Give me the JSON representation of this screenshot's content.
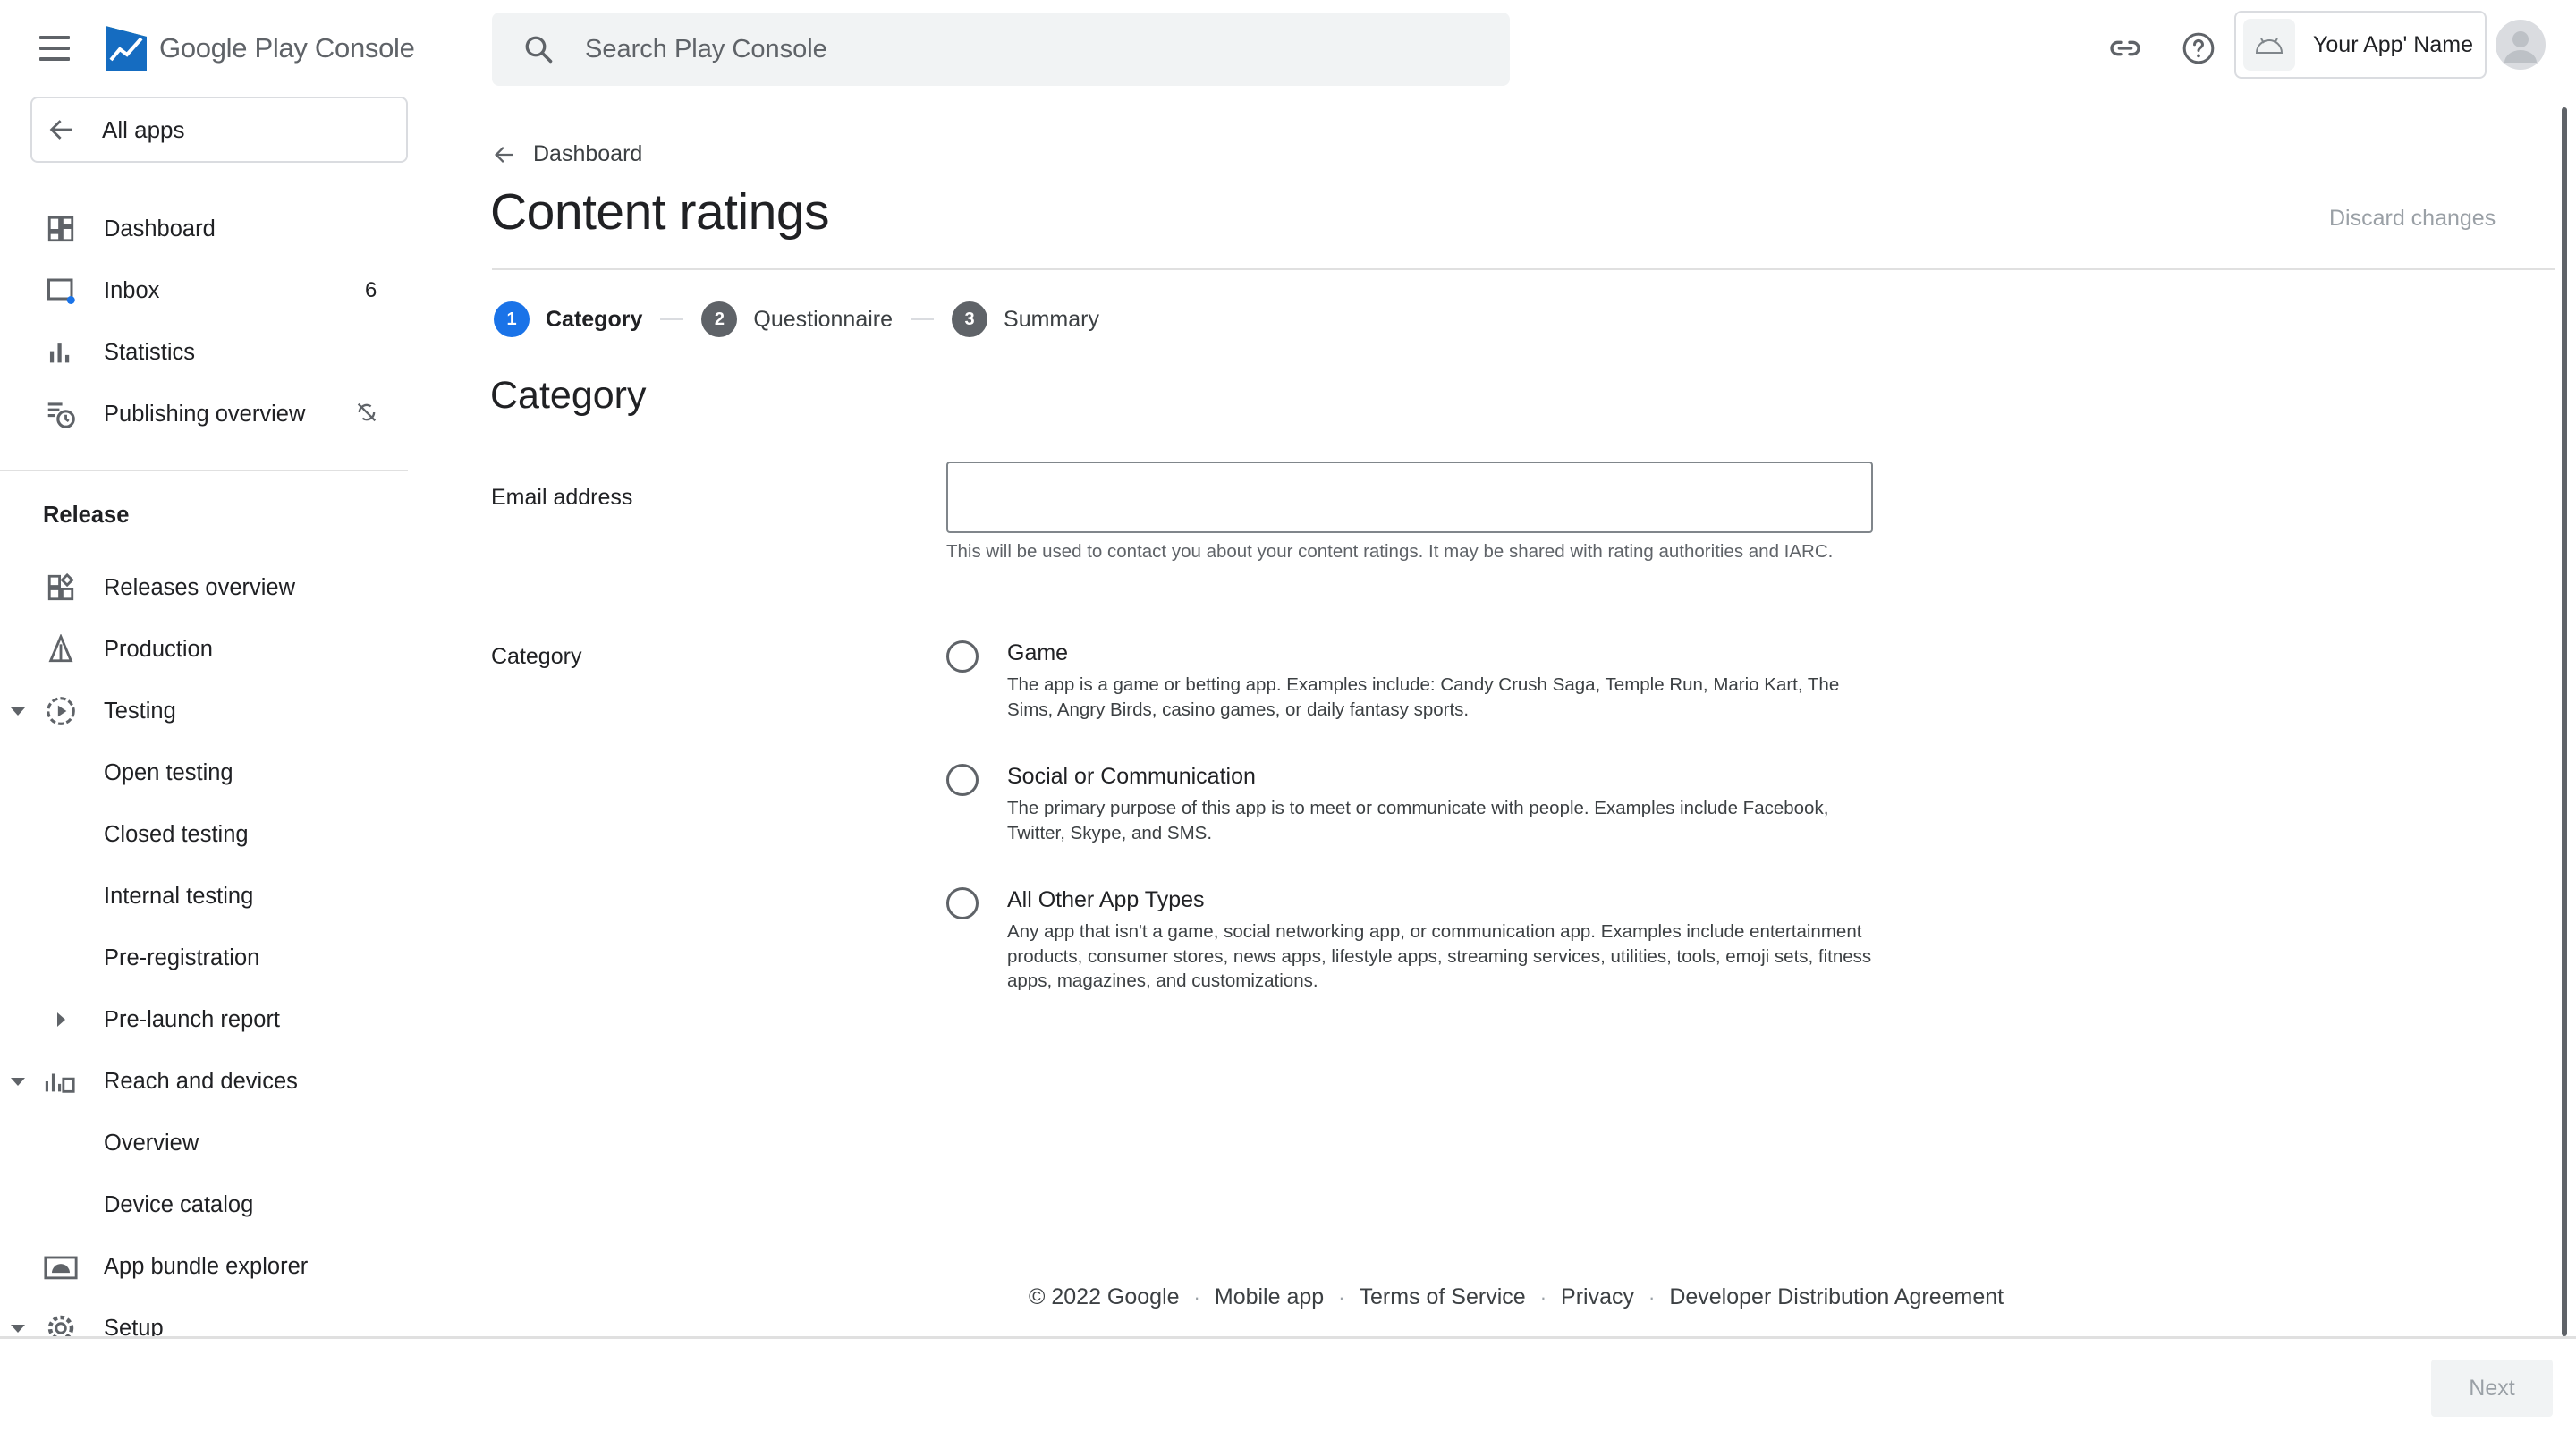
{
  "header": {
    "logo_brand": "Google Play",
    "logo_product": "Console",
    "search_placeholder": "Search Play Console",
    "app_name": "Your App' Name"
  },
  "sidebar": {
    "all_apps": "All apps",
    "items": [
      {
        "label": "Dashboard",
        "icon": "dashboard-icon"
      },
      {
        "label": "Inbox",
        "icon": "inbox-icon",
        "count": "6"
      },
      {
        "label": "Statistics",
        "icon": "bar-chart-icon"
      },
      {
        "label": "Publishing overview",
        "icon": "publishing-overview-icon",
        "status_icon": "sync-disabled-icon"
      }
    ],
    "release_section": "Release",
    "release_items": [
      {
        "label": "Releases overview",
        "icon": "releases-overview-icon"
      },
      {
        "label": "Production",
        "icon": "production-icon"
      },
      {
        "label": "Testing",
        "icon": "testing-icon",
        "expanded": true
      },
      {
        "label": "Open testing"
      },
      {
        "label": "Closed testing"
      },
      {
        "label": "Internal testing"
      },
      {
        "label": "Pre-registration"
      },
      {
        "label": "Pre-launch report",
        "collapsed": true
      },
      {
        "label": "Reach and devices",
        "icon": "reach-devices-icon",
        "expanded": true
      },
      {
        "label": "Overview"
      },
      {
        "label": "Device catalog"
      },
      {
        "label": "App bundle explorer",
        "icon": "app-bundle-icon"
      },
      {
        "label": "Setup",
        "icon": "gear-icon",
        "expanded": true
      }
    ]
  },
  "main": {
    "back_label": "Dashboard",
    "title": "Content ratings",
    "discard": "Discard changes",
    "steps": [
      {
        "num": "1",
        "label": "Category",
        "active": true
      },
      {
        "num": "2",
        "label": "Questionnaire"
      },
      {
        "num": "3",
        "label": "Summary"
      }
    ],
    "section_heading": "Category",
    "email": {
      "label": "Email address",
      "value": "",
      "helper": "This will be used to contact you about your content ratings. It may be shared with rating authorities and IARC."
    },
    "category": {
      "label": "Category",
      "options": [
        {
          "title": "Game",
          "desc": "The app is a game or betting app. Examples include: Candy Crush Saga, Temple Run, Mario Kart, The Sims, Angry Birds, casino games, or daily fantasy sports.",
          "selected": false
        },
        {
          "title": "Social or Communication",
          "desc": "The primary purpose of this app is to meet or communicate with people. Examples include Facebook, Twitter, Skype, and SMS.",
          "selected": false
        },
        {
          "title": "All Other App Types",
          "desc": "Any app that isn't a game, social networking app, or communication app. Examples include entertainment products, consumer stores, news apps, lifestyle apps, streaming services, utilities, tools, emoji sets, fitness apps, magazines, and customizations.",
          "selected": false
        }
      ]
    }
  },
  "footer": {
    "copyright": "© 2022 Google",
    "links": [
      "Mobile app",
      "Terms of Service",
      "Privacy",
      "Developer Distribution Agreement"
    ]
  },
  "actions": {
    "next": "Next"
  },
  "colors": {
    "accent": "#1a73e8",
    "text": "#202124",
    "muted": "#5f6368",
    "divider": "#e0e0e0"
  }
}
